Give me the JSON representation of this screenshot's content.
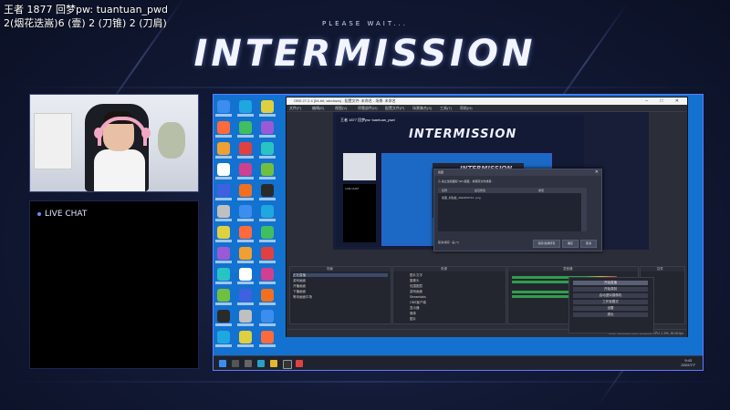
{
  "overlay": {
    "line1": "王者 1877  回梦pw: tuantuan_pwd",
    "line2": "2(烟花迭嵩)6 (壹) 2 (刀锥) 2 (刀肩)"
  },
  "banner": {
    "subtitle": "PLEASE WAIT...",
    "title": "INTERMISSION"
  },
  "chat": {
    "label": "LIVE CHAT"
  },
  "obs": {
    "window_title": "OBS 27.2.4 (64-bit, windows) - 配置文件: 未命名 - 场景: 未命名",
    "menu": [
      "文件(F)",
      "编辑(E)",
      "视图(V)",
      "停靠部件(D)",
      "配置文件(P)",
      "场景集合(S)",
      "工具(T)",
      "帮助(H)"
    ],
    "preview_title": "INTERMISSION",
    "preview_pw": "王者 1877  回梦pw: tuantuan_pwd",
    "preview_chat": "LIVE CHAT",
    "dialog": {
      "title": "截图",
      "message": "禁止加载图标 (W)  截图，将保存文件或者...",
      "col_name": "名称",
      "col_size": "最近修改",
      "col_type": "类型",
      "row_name": "截图_剪贴板_2022070714...png",
      "footer": "取消/保存 : 是 (Y)",
      "btn_confirm": "保存/选择所有",
      "btn_ok": "确定",
      "btn_cancel": "取消"
    },
    "docks": {
      "scenes_label": "场景",
      "sources_label": "来源",
      "mixer_label": "混音器",
      "controls_label": "控件",
      "scenes": [
        "正在直播",
        "游戏画面",
        "开播画面",
        "下播画面",
        "等待画面中场"
      ],
      "sources": [
        "图片文字",
        "摄像头",
        "包围图层",
        "游戏画面",
        "Streamlabs",
        "OBS客户端",
        "显示器",
        "媒体",
        "图片"
      ],
      "controls": [
        "开始直播",
        "开始录制",
        "启动虚拟摄像机",
        "工作室模式",
        "设置",
        "退出"
      ]
    },
    "status": "LIVE: 00:00:00   REC: 00:00:00   CPU: 1.9%, 30.00 fps"
  },
  "taskbar": {
    "time": "9:43",
    "date": "2022/7/7"
  }
}
